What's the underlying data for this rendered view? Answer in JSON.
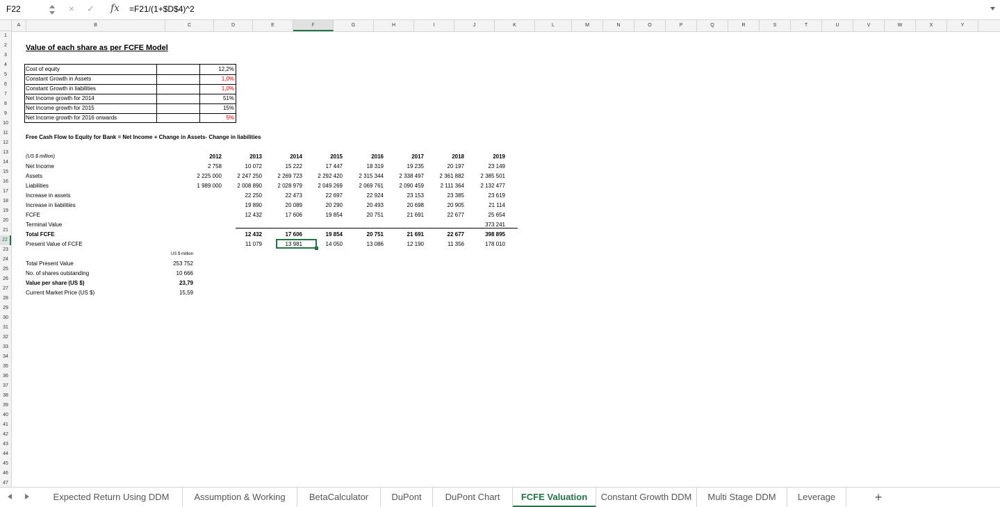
{
  "name_box": "F22",
  "formula": "=F21/(1+$D$4)^2",
  "columns": [
    "A",
    "B",
    "C",
    "D",
    "E",
    "F",
    "G",
    "H",
    "I",
    "J",
    "K",
    "L",
    "M",
    "N",
    "O",
    "P",
    "Q",
    "R",
    "S",
    "T",
    "U",
    "V",
    "W",
    "X",
    "Y"
  ],
  "selected_column": "F",
  "selected_row": "22",
  "title": "Value of each share as per FCFE Model",
  "params": [
    {
      "label": "Cost of equity",
      "value": "12,2%",
      "red": false
    },
    {
      "label": "Constant Growth in Assets",
      "value": "1,0%",
      "red": true
    },
    {
      "label": "Constant Growth in liabilities",
      "value": "1,0%",
      "red": true
    },
    {
      "label": "Net Income growth for 2014",
      "value": "51%",
      "red": false
    },
    {
      "label": "Net Income growth for 2015",
      "value": "15%",
      "red": false
    },
    {
      "label": "Net Income growth for 2016 onwards",
      "value": "5%",
      "red": true
    }
  ],
  "fcfe_formula_label": "Free Cash Flow to Equity for Bank  = Net Income + Change in Assets- Change in liabilities",
  "units_label": "(US $ million)",
  "years": [
    "2012",
    "2013",
    "2014",
    "2015",
    "2016",
    "2017",
    "2018",
    "2019"
  ],
  "rows": [
    {
      "label": "Net Income",
      "bold": false,
      "values": [
        "2 758",
        "10 072",
        "15 222",
        "17 447",
        "18 319",
        "19 235",
        "20 197",
        "23 149"
      ]
    },
    {
      "label": "Assets",
      "bold": false,
      "values": [
        "2 225 000",
        "2 247 250",
        "2 269 723",
        "2 292 420",
        "2 315 344",
        "2 338 497",
        "2 361 882",
        "2 385 501"
      ]
    },
    {
      "label": "Liabilities",
      "bold": false,
      "values": [
        "1 989 000",
        "2 008 890",
        "2 028 979",
        "2 049 269",
        "2 069 761",
        "2 090 459",
        "2 111 364",
        "2 132 477"
      ]
    },
    {
      "label": "Increase in assets",
      "bold": false,
      "values": [
        "",
        "22 250",
        "22 473",
        "22 697",
        "22 924",
        "23 153",
        "23 385",
        "23 619"
      ]
    },
    {
      "label": "Increase in liabilities",
      "bold": false,
      "values": [
        "",
        "19 890",
        "20 089",
        "20 290",
        "20 493",
        "20 698",
        "20 905",
        "21 114"
      ]
    },
    {
      "label": "FCFE",
      "bold": false,
      "values": [
        "",
        "12 432",
        "17 606",
        "19 854",
        "20 751",
        "21 691",
        "22 677",
        "25 654"
      ]
    },
    {
      "label": "Terminal Value",
      "bold": false,
      "values": [
        "",
        "",
        "",
        "",
        "",
        "",
        "",
        "373 241"
      ]
    },
    {
      "label": "Total FCFE",
      "bold": true,
      "values": [
        "",
        "12 432",
        "17 606",
        "19 854",
        "20 751",
        "21 691",
        "22 677",
        "398 895"
      ]
    },
    {
      "label": "Present Value of FCFE",
      "bold": false,
      "values": [
        "",
        "11 079",
        "13 981",
        "14 050",
        "13 086",
        "12 190",
        "11 356",
        "178 010"
      ]
    }
  ],
  "summary_units": "US $ million",
  "summary": [
    {
      "label": "Total Present Value",
      "value": "253 752",
      "bold": false
    },
    {
      "label": "No.  of shares outstanding",
      "value": "10 666",
      "bold": false
    },
    {
      "label": "Value per share (US $)",
      "value": "23,79",
      "bold": true
    },
    {
      "label": "Current Market Price (US $)",
      "value": "15,59",
      "bold": false
    }
  ],
  "tabs": [
    "Expected Return Using DDM",
    "Assumption & Working",
    "BetaCalculator",
    "DuPont",
    "DuPont Chart",
    "FCFE Valuation",
    "Constant Growth DDM",
    "Multi Stage DDM",
    "Leverage"
  ],
  "active_tab": "FCFE Valuation",
  "icons": {
    "cancel": "×",
    "confirm": "✓",
    "fx": "fx",
    "add": "+"
  }
}
